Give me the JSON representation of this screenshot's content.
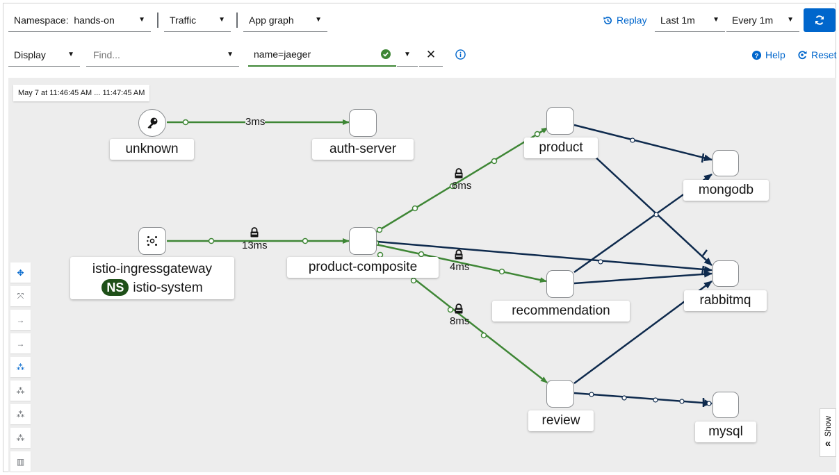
{
  "toolbar": {
    "namespace": "Namespace:  hands-on",
    "traffic": "Traffic",
    "graph_type": "App graph",
    "replay": "Replay",
    "duration": "Last 1m",
    "refresh": "Every 1m",
    "display": "Display",
    "find_placeholder": "Find...",
    "hide_value": "name=jaeger",
    "help": "Help",
    "reset": "Reset"
  },
  "graph": {
    "timestamp": "May 7 at 11:46:45 AM ... 11:47:45 AM",
    "nodes": {
      "unknown": "unknown",
      "auth_server": "auth-server",
      "ingress": "istio-ingressgateway",
      "ns_badge": "NS",
      "ns_name": "istio-system",
      "product_composite": "product-composite",
      "product": "product",
      "recommendation": "recommendation",
      "review": "review",
      "mongodb": "mongodb",
      "rabbitmq": "rabbitmq",
      "mysql": "mysql"
    },
    "edges": {
      "unknown_auth": "3ms",
      "ingress_pc": "13ms",
      "pc_product": "6ms",
      "pc_recommendation": "4ms",
      "pc_review": "8ms"
    },
    "colors": {
      "healthy_edge": "#3e8635",
      "tcp_edge": "#0e2a4d",
      "accent": "#0066cc",
      "ns_badge": "#1e4f18"
    }
  },
  "side_panel": {
    "show": "Show"
  }
}
